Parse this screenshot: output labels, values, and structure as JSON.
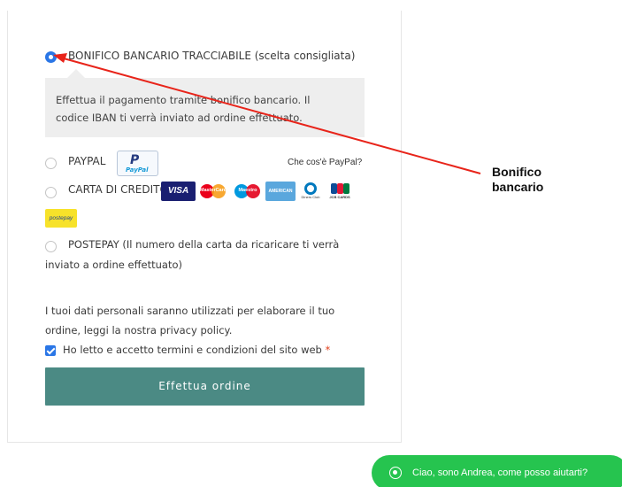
{
  "payment": {
    "options": [
      {
        "label": "BONIFICO BANCARIO TRACCIABILE (scelta consigliata)",
        "selected": true
      },
      {
        "label": "PAYPAL",
        "selected": false
      },
      {
        "label": "CARTA DI CREDITO",
        "selected": false
      },
      {
        "label": "POSTEPAY (Il numero della carta da ricaricare ti verrà",
        "label_line2": "inviato a ordine effettuato)",
        "selected": false
      }
    ],
    "bank_description_line1": "Effettua il pagamento tramite bonifico bancario. Il",
    "bank_description_line2": "codice IBAN ti verrà inviato ad ordine effettuato.",
    "paypal_whatis": "Che cos'è PayPal?",
    "paypal_logo_text": "PayPal",
    "card_logos": {
      "visa": "VISA",
      "mastercard": "MasterCard",
      "maestro": "Maestro",
      "amex": "AMERICAN EXPRESS",
      "diners": "Diners Club",
      "jcb": "JCB CARDS"
    },
    "postepay_logo_text": "postepay"
  },
  "privacy": {
    "line1": "I tuoi dati personali saranno utilizzati per elaborare il tuo",
    "line2_prefix": "ordine, leggi la nostra ",
    "link": "privacy policy",
    "line2_suffix": "."
  },
  "terms": {
    "label": "Ho letto e accetto termini e condizioni del sito web",
    "required_mark": "*",
    "checked": true
  },
  "order_button": "Effettua ordine",
  "annotation": {
    "line1": "Bonifico",
    "line2": "bancario"
  },
  "chat": {
    "label": "Ciao, sono Andrea, come posso aiutarti?"
  },
  "colors": {
    "accent": "#2a76e6",
    "button": "#4b8a84",
    "arrow": "#e8241a",
    "chat": "#26c44f"
  }
}
